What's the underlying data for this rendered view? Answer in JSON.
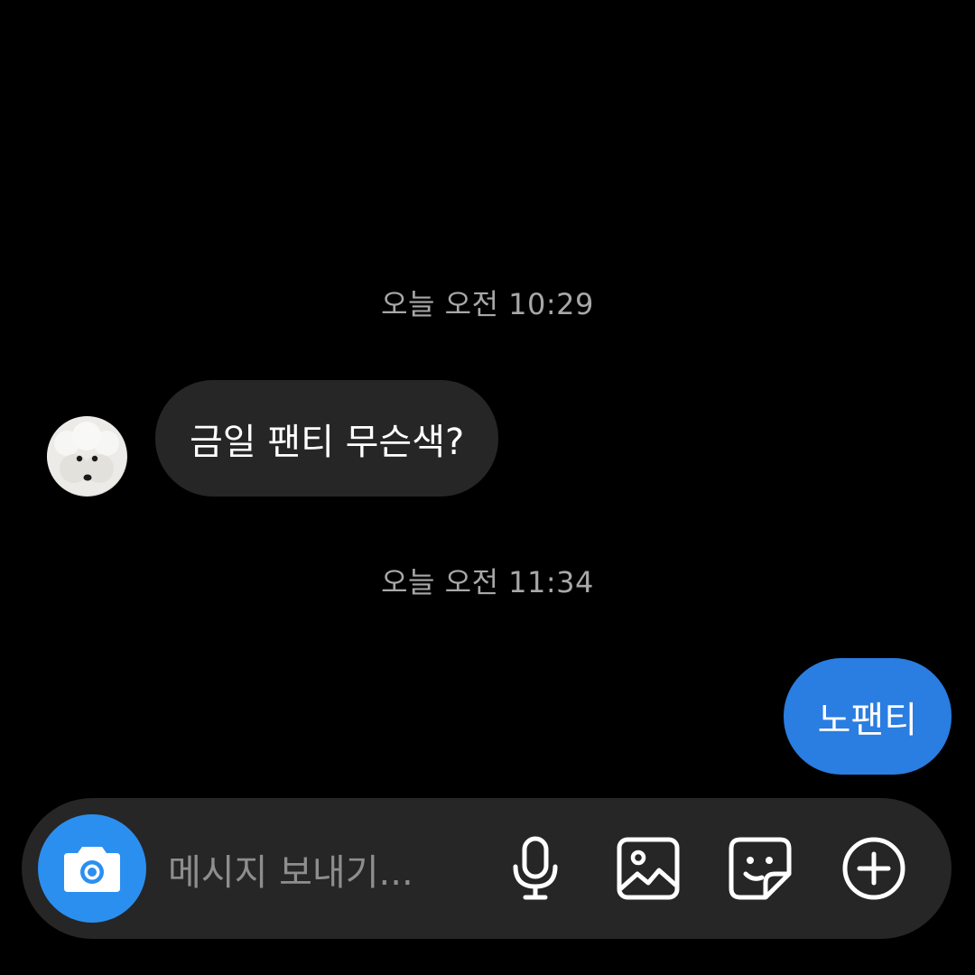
{
  "chat": {
    "timestamps": [
      "오늘 오전 10:29",
      "오늘 오전 11:34"
    ],
    "incoming_message": "금일 팬티 무슨색?",
    "outgoing_message": "노팬티"
  },
  "composer": {
    "placeholder": "메시지 보내기..."
  },
  "colors": {
    "background": "#000000",
    "incoming_bubble": "#262626",
    "outgoing_bubble": "#2a7de1",
    "camera_button": "#2b8ff0",
    "timestamp_text": "#a8a8a8",
    "placeholder_text": "#8e8e8e"
  },
  "icons": {
    "camera": "camera-icon",
    "mic": "microphone-icon",
    "image": "image-icon",
    "sticker": "sticker-icon",
    "plus": "plus-circle-icon"
  }
}
